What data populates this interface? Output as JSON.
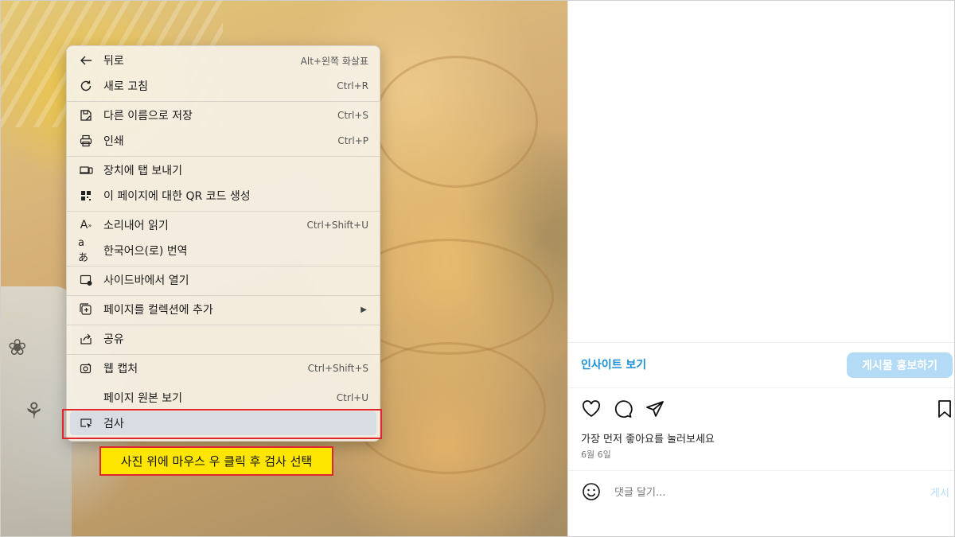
{
  "context_menu": {
    "items": [
      {
        "label": "뒤로",
        "shortcut": "Alt+왼쪽 화살표",
        "icon": "back-arrow-icon"
      },
      {
        "label": "새로 고침",
        "shortcut": "Ctrl+R",
        "icon": "refresh-icon"
      },
      {
        "label": "다른 이름으로 저장",
        "shortcut": "Ctrl+S",
        "icon": "save-as-icon"
      },
      {
        "label": "인쇄",
        "shortcut": "Ctrl+P",
        "icon": "print-icon"
      },
      {
        "label": "장치에 탭 보내기",
        "shortcut": "",
        "icon": "send-to-device-icon"
      },
      {
        "label": "이 페이지에 대한 QR 코드 생성",
        "shortcut": "",
        "icon": "qr-code-icon"
      },
      {
        "label": "소리내어 읽기",
        "shortcut": "Ctrl+Shift+U",
        "icon": "read-aloud-icon"
      },
      {
        "label": "한국어으(로) 번역",
        "shortcut": "",
        "icon": "translate-icon"
      },
      {
        "label": "사이드바에서 열기",
        "shortcut": "",
        "icon": "sidebar-open-icon"
      },
      {
        "label": "페이지를 컬렉션에 추가",
        "shortcut": "",
        "icon": "collections-add-icon",
        "submenu": true
      },
      {
        "label": "공유",
        "shortcut": "",
        "icon": "share-icon"
      },
      {
        "label": "웹 캡처",
        "shortcut": "Ctrl+Shift+S",
        "icon": "web-capture-icon"
      },
      {
        "label": "페이지 원본 보기",
        "shortcut": "Ctrl+U",
        "icon": ""
      },
      {
        "label": "검사",
        "shortcut": "",
        "icon": "inspect-icon",
        "active": true
      }
    ]
  },
  "annotation": {
    "callout_text": "사진 위에 마우스 우 클릭 후 검사 선택",
    "highlight_color": "#e0262d",
    "callout_bg": "#ffe600"
  },
  "panel": {
    "insight_link": "인사이트 보기",
    "promote_button": "게시물 홍보하기",
    "likes_prompt": "가장 먼저 좋아요를 눌러보세요",
    "date": "6월 6일",
    "comment_placeholder": "댓글 달기...",
    "post_button": "게시",
    "icons": [
      "heart-icon",
      "comment-icon",
      "share-send-icon",
      "bookmark-icon",
      "emoji-icon"
    ],
    "accent_color": "#1a8fd6"
  }
}
